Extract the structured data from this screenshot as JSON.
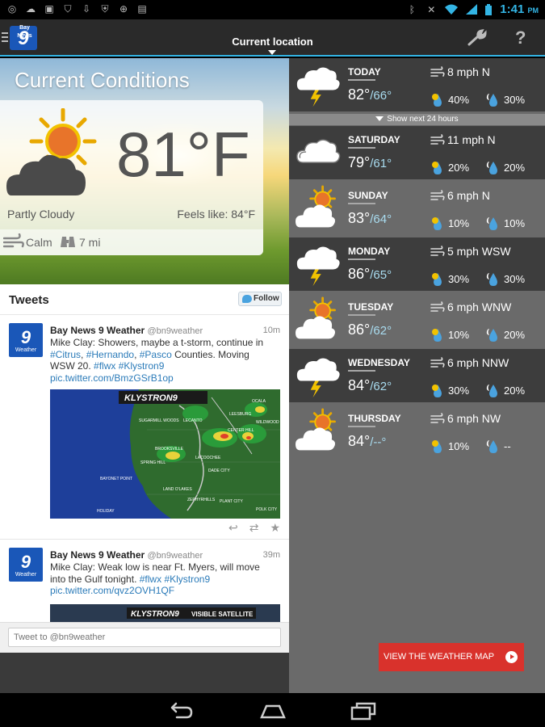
{
  "status_bar": {
    "time": "1:41",
    "ampm": "PM",
    "left_icons": [
      "location-icon",
      "cloud-download-icon",
      "image-icon",
      "shield-check-icon",
      "download-icon",
      "badge-icon",
      "globe-icon",
      "briefcase-check-icon"
    ],
    "right_icons": [
      "bluetooth-icon",
      "mute-icon",
      "wifi-icon",
      "signal-icon",
      "battery-icon"
    ]
  },
  "action_bar": {
    "logo_text": "9",
    "logo_small": "Bay News",
    "title": "Current location"
  },
  "current": {
    "heading": "Current Conditions",
    "temp": "81°F",
    "condition": "Partly Cloudy",
    "feels_like": "Feels like: 84°F",
    "wind": "Calm",
    "visibility": "7 mi"
  },
  "tweets": {
    "heading": "Tweets",
    "follow_label": "Follow",
    "input_placeholder": "Tweet to @bn9weather",
    "items": [
      {
        "avatar_big": "9",
        "avatar_small": "Weather",
        "name": "Bay News 9 Weather",
        "handle": "@bn9weather",
        "time": "10m",
        "text_a": "Mike Clay: Showers, maybe a t-storm, continue in ",
        "link_1": "#Citrus",
        "sep_1": ", ",
        "link_2": "#Hernando",
        "sep_2": ", ",
        "link_3": "#Pasco",
        "text_b": " Counties. Moving WSW 20. ",
        "link_4": "#flwx",
        "sep_3": " ",
        "link_5": "#Klystron9",
        "link_6": "pic.twitter.com/BmzGSrB1op",
        "image_brand": "KLYSTRON9",
        "map_labels": [
          "SUGARMILL WOODS",
          "LECANTO",
          "LEESBURG",
          "WILDWOOD",
          "BROOKSVILLE",
          "LAND O'LAKES",
          "SPRING HILL",
          "DADE CITY",
          "LACOOCHEE",
          "BAYONET POINT",
          "ZEPHYRHILLS",
          "PLANT CITY",
          "POLK CITY",
          "HOLIDAY",
          "CENTER HILL",
          "OCALA"
        ]
      },
      {
        "avatar_big": "9",
        "avatar_small": "Weather",
        "name": "Bay News 9 Weather",
        "handle": "@bn9weather",
        "time": "39m",
        "text_a": "Mike Clay: Weak low is near Ft. Myers, will move into the Gulf tonight. ",
        "link_1": "#flwx",
        "sep_1": " ",
        "link_2": "#Klystron9",
        "link_3": "pic.twitter.com/qvz2OVH1QF",
        "image_brand": "KLYSTRON9",
        "image_caption": "VISIBLE SATELLITE"
      }
    ]
  },
  "forecast": {
    "next24_label": "Show next 24 hours",
    "days": [
      {
        "name": "TODAY",
        "hi": "82°",
        "lo": "/66°",
        "wind": "8 mph N",
        "rain": "40%",
        "night": "30%",
        "icon": "storm-cloud-icon"
      },
      {
        "name": "SATURDAY",
        "hi": "79°",
        "lo": "/61°",
        "wind": "11 mph N",
        "rain": "20%",
        "night": "20%",
        "icon": "cloudy-icon"
      },
      {
        "name": "SUNDAY",
        "hi": "83°",
        "lo": "/64°",
        "wind": "6 mph N",
        "rain": "10%",
        "night": "10%",
        "icon": "partly-sunny-icon"
      },
      {
        "name": "MONDAY",
        "hi": "86°",
        "lo": "/65°",
        "wind": "5 mph WSW",
        "rain": "30%",
        "night": "30%",
        "icon": "storm-cloud-icon"
      },
      {
        "name": "TUESDAY",
        "hi": "86°",
        "lo": "/62°",
        "wind": "6 mph WNW",
        "rain": "10%",
        "night": "20%",
        "icon": "partly-sunny-icon"
      },
      {
        "name": "WEDNESDAY",
        "hi": "84°",
        "lo": "/62°",
        "wind": "6 mph NNW",
        "rain": "30%",
        "night": "20%",
        "icon": "storm-cloud-icon"
      },
      {
        "name": "THURSDAY",
        "hi": "84°",
        "lo": "/--°",
        "wind": "6 mph NW",
        "rain": "10%",
        "night": "--",
        "icon": "partly-sunny-icon"
      }
    ],
    "view_map_label": "VIEW THE WEATHER MAP"
  },
  "colors": {
    "accent": "#33b5e5",
    "map_button": "#d9322c",
    "brand_blue": "#1a57b8"
  }
}
